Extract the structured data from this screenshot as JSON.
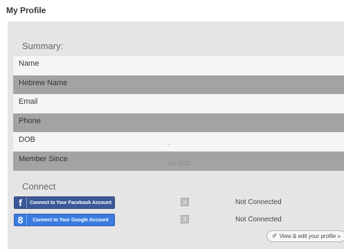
{
  "page": {
    "title": "My Profile"
  },
  "summary": {
    "heading": "Summary:",
    "rows": [
      {
        "label": "Name",
        "value": ""
      },
      {
        "label": "Hebrew Name",
        "value": ""
      },
      {
        "label": "Email",
        "value": ""
      },
      {
        "label": "Phone",
        "value": ""
      },
      {
        "label": "DOB",
        "value": "-"
      },
      {
        "label": "Member Since",
        "value": "Jun 2012"
      }
    ]
  },
  "connect": {
    "heading": "Connect",
    "facebook": {
      "label": "Connect to Your Facebook Account",
      "icon": "f",
      "status": "Not Connected",
      "remove": "X",
      "color": "#3b5998"
    },
    "google": {
      "label": "Connect to Your Google Account",
      "icon": "8",
      "status": "Not Connected",
      "remove": "X",
      "color": "#3a7be0"
    }
  },
  "actions": {
    "view_edit_label": "View & edit your profile »",
    "view_edit_icon": "✐"
  }
}
